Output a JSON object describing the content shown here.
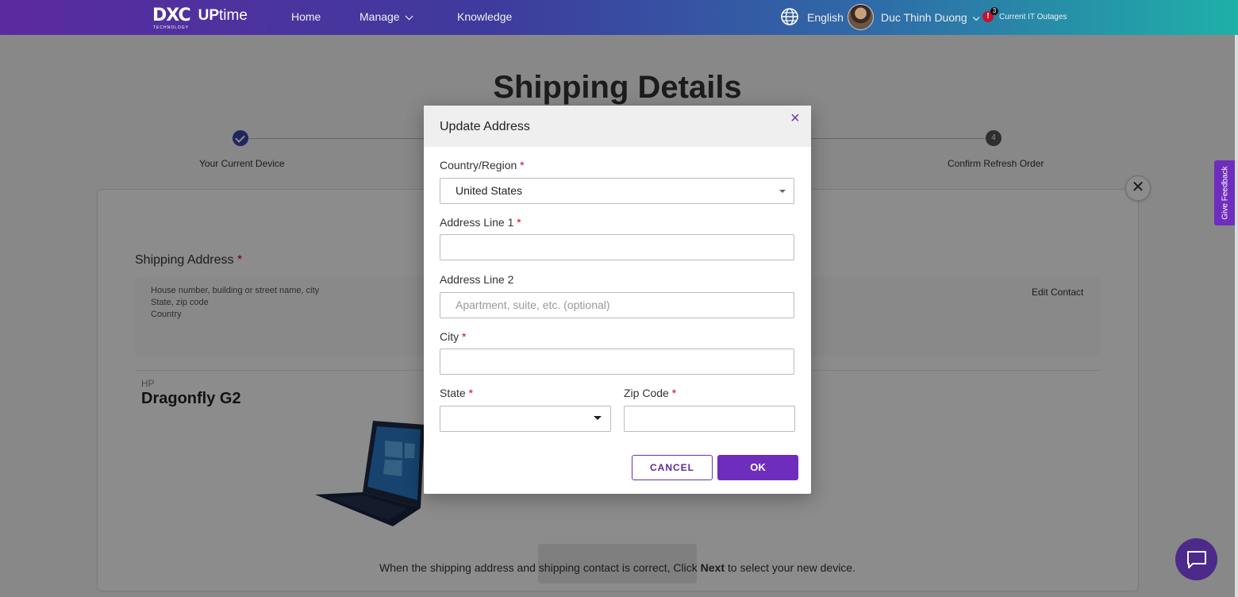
{
  "nav": {
    "logo_main": "DXC",
    "logo_sub": "TECHNOLOGY",
    "logo_product_a": "UP",
    "logo_product_b": "time",
    "home": "Home",
    "manage": "Manage",
    "knowledge": "Knowledge",
    "language": "English",
    "user_name": "Duc Thinh Duong",
    "outage_count": "3",
    "outage_label": "Current IT Outages"
  },
  "page": {
    "title": "Shipping Details",
    "steps": [
      {
        "label": "Your Current Device",
        "status": "done"
      },
      {
        "label": "Confirm Refresh Order",
        "number": "4"
      }
    ],
    "shipping_label": "Shipping Address",
    "required_mark": "*",
    "address_lines": [
      "House number, building or street name, city",
      "State, zip code",
      "Country"
    ],
    "edit_contact": "Edit Contact",
    "device_brand": "HP",
    "device_model": "Dragonfly G2",
    "footer_pre": "When the shipping address and shipping contact is correct, Click ",
    "footer_bold": "Next",
    "footer_post": " to select your new device.",
    "feedback": "Give Feedback"
  },
  "modal": {
    "title": "Update Address",
    "close": "×",
    "country_label": "Country/Region",
    "country_value": "United States",
    "address1_label": "Address Line 1",
    "address1_value": "",
    "address2_label": "Address Line 2",
    "address2_placeholder": "Apartment, suite, etc. (optional)",
    "city_label": "City",
    "city_value": "",
    "state_label": "State",
    "state_value": "",
    "zip_label": "Zip Code",
    "zip_value": "",
    "cancel": "CANCEL",
    "ok": "OK"
  },
  "colors": {
    "accent": "#6f2dbd",
    "required": "#d0021b",
    "step_done": "#3a46a8"
  }
}
